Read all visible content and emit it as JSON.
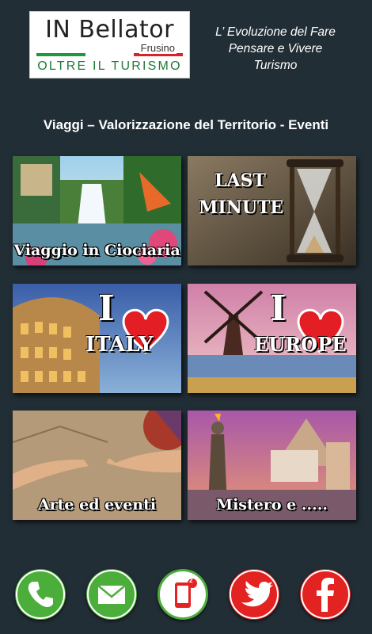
{
  "logo": {
    "title": "IN Bellator",
    "city": "Frusino",
    "subtitle": "OLTRE IL TURISMO"
  },
  "tagline": [
    "L’ Evoluzione del Fare",
    "Pensare e Vivere",
    "Turismo"
  ],
  "section_title": "Viaggi – Valorizzazione del Territorio -  Eventi",
  "tiles": [
    {
      "label": "Viaggio in Ciociaria"
    },
    {
      "label": "",
      "overlay": [
        "LAST",
        "MINUTE"
      ]
    },
    {
      "label": "",
      "overlay": [
        "I",
        "ITALY"
      ]
    },
    {
      "label": "",
      "overlay": [
        "I",
        "EUROPE"
      ]
    },
    {
      "label": "Arte ed eventi"
    },
    {
      "label": "Mistero e ....."
    }
  ],
  "contact_icons": [
    "phone-icon",
    "mail-icon",
    "mobile-notification-icon",
    "twitter-icon",
    "facebook-icon"
  ],
  "badge_count": "2",
  "colors": {
    "background": "#222e36",
    "phone": "#4cae3a",
    "mail": "#4cae3a",
    "red": "#e32222",
    "italy_green": "#1e9a3c",
    "italy_red": "#d8232a"
  }
}
